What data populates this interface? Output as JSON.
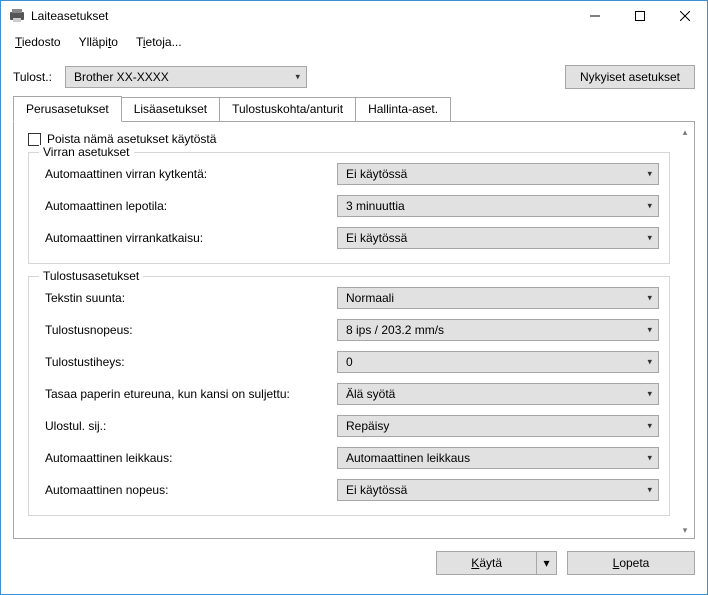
{
  "window": {
    "title": "Laiteasetukset"
  },
  "menu": {
    "file": "Tiedosto",
    "file_u": "T",
    "maint": "Ylläpito",
    "maint_u": "t",
    "about": "Tietoja...",
    "about_u": "i"
  },
  "toprow": {
    "label": "Tulost.:",
    "printer": "Brother  XX-XXXX",
    "currentBtn": "Nykyiset asetukset"
  },
  "tabs": {
    "basic": "Perusasetukset",
    "advanced": "Lisäasetukset",
    "sensors": "Tulostuskohta/anturit",
    "mgmt": "Hallinta-aset."
  },
  "disableLabel": "Poista nämä asetukset käytöstä",
  "power": {
    "legend": "Virran asetukset",
    "autoOnLabel": "Automaattinen virran kytkentä:",
    "autoOnValue": "Ei käytössä",
    "sleepLabel": "Automaattinen lepotila:",
    "sleepValue": "3 minuuttia",
    "autoOffLabel": "Automaattinen virrankatkaisu:",
    "autoOffValue": "Ei käytössä"
  },
  "print": {
    "legend": "Tulostusasetukset",
    "textDirLabel": "Tekstin suunta:",
    "textDirValue": "Normaali",
    "speedLabel": "Tulostusnopeus:",
    "speedValue": "8 ips / 203.2 mm/s",
    "densityLabel": "Tulostustiheys:",
    "densityValue": "0",
    "alignLabel": "Tasaa paperin etureuna, kun kansi on suljettu:",
    "alignValue": "Älä syötä",
    "exitLabel": "Ulostul. sij.:",
    "exitValue": "Repäisy",
    "autoCutLabel": "Automaattinen leikkaus:",
    "autoCutValue": "Automaattinen leikkaus",
    "autoSpeedLabel": "Automaattinen nopeus:",
    "autoSpeedValue": "Ei käytössä"
  },
  "bottom": {
    "apply": "Käytä",
    "apply_u": "K",
    "exit": "Lopeta",
    "exit_u": "L"
  }
}
